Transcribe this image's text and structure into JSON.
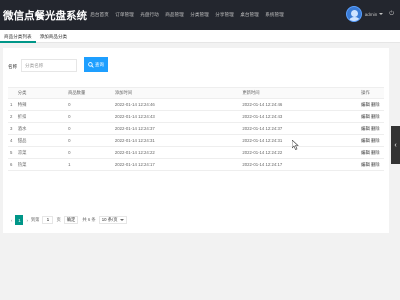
{
  "app": {
    "title": "微信点餐光盘系统"
  },
  "nav": [
    "后台首页",
    "订单管理",
    "光盘行动",
    "商品管理",
    "分类管理",
    "分享管理",
    "桌台管理",
    "系统管理"
  ],
  "user": {
    "name": "admin"
  },
  "tabs": [
    "商品分类列表",
    "添加商品分类"
  ],
  "search": {
    "label": "名称",
    "placeholder": "分类名称",
    "button": "查询"
  },
  "table": {
    "headers": [
      "",
      "分类",
      "商品数量",
      "添加时间",
      "更新时间",
      "操作"
    ],
    "rows": [
      {
        "id": "1",
        "name": "特辣",
        "count": "0",
        "created": "2022-01-14 12:24:46",
        "updated": "2022-01-14 12:24:46",
        "edit": "编辑",
        "del": "删除"
      },
      {
        "id": "2",
        "name": "折扣",
        "count": "0",
        "created": "2022-01-14 12:24:43",
        "updated": "2022-01-14 12:24:43",
        "edit": "编辑",
        "del": "删除"
      },
      {
        "id": "3",
        "name": "酒水",
        "count": "0",
        "created": "2022-01-14 12:24:37",
        "updated": "2022-01-14 12:24:37",
        "edit": "编辑",
        "del": "删除"
      },
      {
        "id": "4",
        "name": "甜品",
        "count": "0",
        "created": "2022-01-14 12:24:31",
        "updated": "2022-01-14 12:24:31",
        "edit": "编辑",
        "del": "删除"
      },
      {
        "id": "5",
        "name": "凉菜",
        "count": "0",
        "created": "2022-01-14 12:24:22",
        "updated": "2022-01-14 12:24:22",
        "edit": "编辑",
        "del": "删除"
      },
      {
        "id": "6",
        "name": "热菜",
        "count": "1",
        "created": "2022-01-14 12:24:17",
        "updated": "2022-01-14 12:24:17",
        "edit": "编辑",
        "del": "删除"
      }
    ]
  },
  "pager": {
    "current": "1",
    "goto_label": "到第",
    "input_value": "1",
    "page_unit": "页",
    "go_button": "确定",
    "total": "共 6 条",
    "page_size": "10 条/页"
  },
  "colors": {
    "topbar": "#23262e",
    "accent": "#009688",
    "button": "#1e9fff"
  }
}
